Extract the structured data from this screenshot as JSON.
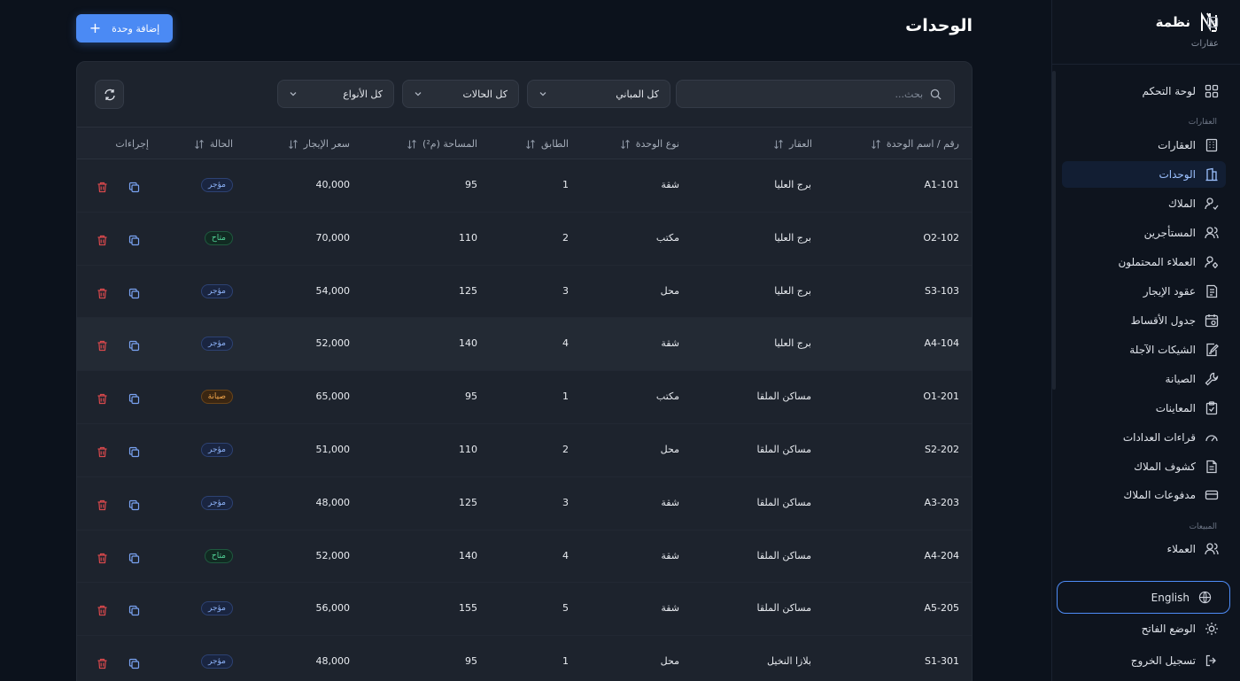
{
  "brand": {
    "name": "نظمة",
    "subtitle": "عقارات"
  },
  "page": {
    "title": "الوحدات",
    "add_button": "إضافة وحدة"
  },
  "filters": {
    "search_placeholder": "بحث...",
    "buildings": "كل المباني",
    "statuses": "كل الحالات",
    "types": "كل الأنواع"
  },
  "table": {
    "headers": {
      "unit": "رقم / اسم الوحدة",
      "property": "العقار",
      "type": "نوع الوحدة",
      "floor": "الطابق",
      "area": "المساحة (م²)",
      "rent": "سعر الإيجار",
      "status": "الحالة",
      "actions": "إجراءات"
    },
    "rows": [
      {
        "unit": "A1-101",
        "property": "برج العليا",
        "type": "شقة",
        "floor": "1",
        "area": "95",
        "rent": "40,000",
        "status": "مؤجر",
        "status_kind": "rented"
      },
      {
        "unit": "O2-102",
        "property": "برج العليا",
        "type": "مكتب",
        "floor": "2",
        "area": "110",
        "rent": "70,000",
        "status": "متاح",
        "status_kind": "available"
      },
      {
        "unit": "S3-103",
        "property": "برج العليا",
        "type": "محل",
        "floor": "3",
        "area": "125",
        "rent": "54,000",
        "status": "مؤجر",
        "status_kind": "rented"
      },
      {
        "unit": "A4-104",
        "property": "برج العليا",
        "type": "شقة",
        "floor": "4",
        "area": "140",
        "rent": "52,000",
        "status": "مؤجر",
        "status_kind": "rented"
      },
      {
        "unit": "O1-201",
        "property": "مساكن الملقا",
        "type": "مكتب",
        "floor": "1",
        "area": "95",
        "rent": "65,000",
        "status": "صيانة",
        "status_kind": "maintenance"
      },
      {
        "unit": "S2-202",
        "property": "مساكن الملقا",
        "type": "محل",
        "floor": "2",
        "area": "110",
        "rent": "51,000",
        "status": "مؤجر",
        "status_kind": "rented"
      },
      {
        "unit": "A3-203",
        "property": "مساكن الملقا",
        "type": "شقة",
        "floor": "3",
        "area": "125",
        "rent": "48,000",
        "status": "مؤجر",
        "status_kind": "rented"
      },
      {
        "unit": "A4-204",
        "property": "مساكن الملقا",
        "type": "شقة",
        "floor": "4",
        "area": "140",
        "rent": "52,000",
        "status": "متاح",
        "status_kind": "available"
      },
      {
        "unit": "A5-205",
        "property": "مساكن الملقا",
        "type": "شقة",
        "floor": "5",
        "area": "155",
        "rent": "56,000",
        "status": "مؤجر",
        "status_kind": "rented"
      },
      {
        "unit": "S1-301",
        "property": "بلازا النخيل",
        "type": "محل",
        "floor": "1",
        "area": "95",
        "rent": "48,000",
        "status": "مؤجر",
        "status_kind": "rented"
      }
    ]
  },
  "sidebar": {
    "section_properties": "العقارات",
    "section_sales": "المبيعات",
    "items": [
      {
        "label": "لوحة التحكم",
        "icon": "dashboard-icon"
      },
      {
        "label": "العقارات",
        "icon": "building-icon"
      },
      {
        "label": "الوحدات",
        "icon": "units-icon",
        "active": true
      },
      {
        "label": "الملاك",
        "icon": "owner-icon"
      },
      {
        "label": "المستأجرين",
        "icon": "tenants-icon"
      },
      {
        "label": "العملاء المحتملون",
        "icon": "leads-icon"
      },
      {
        "label": "عقود الإيجار",
        "icon": "contract-icon"
      },
      {
        "label": "جدول الأقساط",
        "icon": "calendar-icon"
      },
      {
        "label": "الشيكات الآجلة",
        "icon": "cheque-icon"
      },
      {
        "label": "الصيانة",
        "icon": "wrench-icon"
      },
      {
        "label": "المعاينات",
        "icon": "clipboard-icon"
      },
      {
        "label": "قراءات العدادات",
        "icon": "gauge-icon"
      },
      {
        "label": "كشوف الملاك",
        "icon": "statement-icon"
      },
      {
        "label": "مدفوعات الملاك",
        "icon": "card-icon"
      },
      {
        "label": "العملاء",
        "icon": "clients-icon"
      }
    ],
    "language": "English",
    "theme": "الوضع الفاتح",
    "logout": "تسجيل الخروج"
  },
  "colors": {
    "accent": "#4b8af4",
    "rented": "#8bb0f5",
    "available": "#52d398",
    "maintenance": "#f2a54a",
    "danger": "#d8484c"
  }
}
